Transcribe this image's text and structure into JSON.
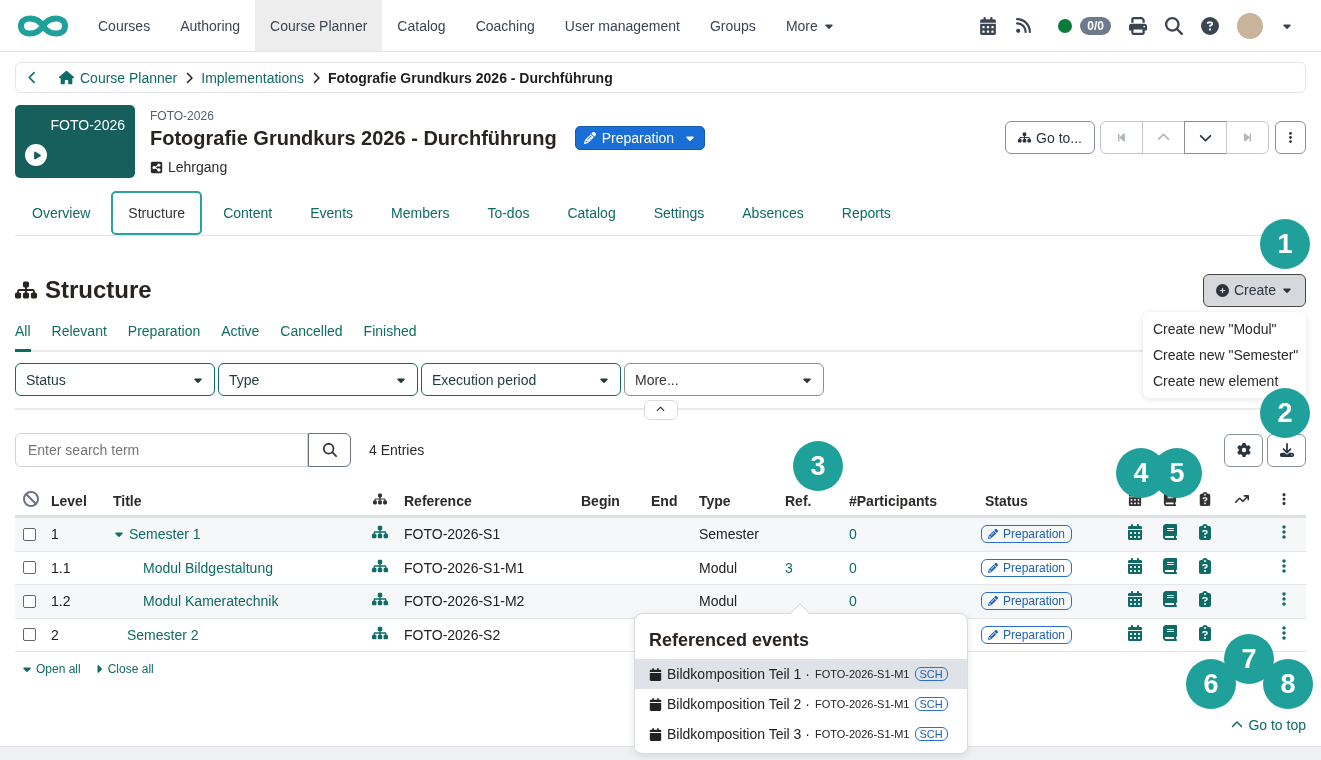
{
  "nav": {
    "items": [
      {
        "label": "Courses",
        "selected": false
      },
      {
        "label": "Authoring",
        "selected": false
      },
      {
        "label": "Course Planner",
        "selected": true
      },
      {
        "label": "Catalog",
        "selected": false
      },
      {
        "label": "Coaching",
        "selected": false
      },
      {
        "label": "User management",
        "selected": false
      },
      {
        "label": "Groups",
        "selected": false
      },
      {
        "label": "More",
        "selected": false,
        "dropdown": true
      }
    ],
    "online": true,
    "counter": "0/0"
  },
  "breadcrumb": [
    "Course Planner",
    "Implementations",
    "Fotografie Grundkurs 2026 - Durchführung"
  ],
  "header": {
    "thumb_label": "FOTO-2026",
    "subtitle": "FOTO-2026",
    "title": "Fotografie Grundkurs 2026 - Durchführung",
    "status": "Preparation",
    "type": "Lehrgang",
    "goto": "Go to..."
  },
  "tabs": [
    {
      "label": "Overview",
      "selected": false
    },
    {
      "label": "Structure",
      "selected": true
    },
    {
      "label": "Content",
      "selected": false
    },
    {
      "label": "Events",
      "selected": false
    },
    {
      "label": "Members",
      "selected": false
    },
    {
      "label": "To-dos",
      "selected": false
    },
    {
      "label": "Catalog",
      "selected": false
    },
    {
      "label": "Settings",
      "selected": false
    },
    {
      "label": "Absences",
      "selected": false
    },
    {
      "label": "Reports",
      "selected": false
    }
  ],
  "section": {
    "title": "Structure",
    "create": "Create",
    "create_menu": [
      "Create new \"Modul\"",
      "Create new \"Semester\"",
      "Create new element"
    ]
  },
  "filter_tabs": [
    {
      "label": "All",
      "selected": true
    },
    {
      "label": "Relevant",
      "selected": false
    },
    {
      "label": "Preparation",
      "selected": false
    },
    {
      "label": "Active",
      "selected": false
    },
    {
      "label": "Cancelled",
      "selected": false
    },
    {
      "label": "Finished",
      "selected": false
    }
  ],
  "filters": [
    {
      "label": "Status",
      "active": true
    },
    {
      "label": "Type",
      "active": true
    },
    {
      "label": "Execution period",
      "active": true
    },
    {
      "label": "More...",
      "active": false
    }
  ],
  "search": {
    "placeholder": "Enter search term",
    "count": "4 Entries"
  },
  "table": {
    "columns": [
      {
        "kind": "select"
      },
      {
        "kind": "text",
        "label": "Level"
      },
      {
        "kind": "text",
        "label": "Title"
      },
      {
        "kind": "structure"
      },
      {
        "kind": "text",
        "label": "Reference"
      },
      {
        "kind": "text",
        "label": "Begin"
      },
      {
        "kind": "text",
        "label": "End"
      },
      {
        "kind": "text",
        "label": "Type"
      },
      {
        "kind": "text",
        "label": "Ref."
      },
      {
        "kind": "text",
        "label": "#Participants"
      },
      {
        "kind": "text",
        "label": "Status"
      },
      {
        "kind": "calendar"
      },
      {
        "kind": "book"
      },
      {
        "kind": "test"
      },
      {
        "kind": "chart"
      },
      {
        "kind": "actions"
      }
    ],
    "rows": [
      {
        "checked": false,
        "level": "1",
        "title": "Semester 1",
        "expanded": true,
        "reference": "FOTO-2026-S1",
        "type": "Semester",
        "participants": "0",
        "status": "Preparation",
        "children": [
          {
            "checked": false,
            "level": "1.1",
            "title": "Modul Bildgestaltung",
            "reference": "FOTO-2026-S1-M1",
            "type": "Modul",
            "refs": "3",
            "participants": "0",
            "status": "Preparation"
          },
          {
            "checked": false,
            "level": "1.2",
            "title": "Modul Kameratechnik",
            "reference": "FOTO-2026-S1-M2",
            "type": "Modul",
            "participants": "0",
            "status": "Preparation"
          }
        ]
      },
      {
        "checked": false,
        "level": "2",
        "title": "Semester 2",
        "reference": "FOTO-2026-S2",
        "status": "Preparation"
      }
    ]
  },
  "tree_links": [
    "Open all",
    "Close all"
  ],
  "go_to_top": "Go to top",
  "referenced_events": {
    "title": "Referenced events",
    "separator": "·",
    "items": [
      {
        "title": "Bildkomposition Teil 1",
        "reference": "FOTO-2026-S1-M1",
        "tag": "SCH",
        "selected": true
      },
      {
        "title": "Bildkomposition Teil 2",
        "reference": "FOTO-2026-S1-M1",
        "tag": "SCH",
        "selected": false
      },
      {
        "title": "Bildkomposition Teil 3",
        "reference": "FOTO-2026-S1-M1",
        "tag": "SCH",
        "selected": false
      }
    ]
  },
  "callouts": [
    "1",
    "2",
    "3",
    "4",
    "5",
    "6",
    "7",
    "8"
  ]
}
